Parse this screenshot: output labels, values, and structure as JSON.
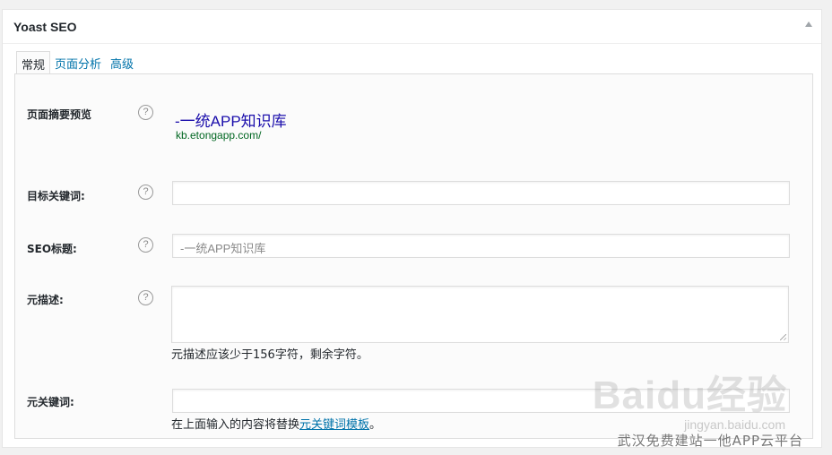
{
  "metabox": {
    "title": "Yoast SEO"
  },
  "tabs": [
    {
      "label": "常规"
    },
    {
      "label": "页面分析"
    },
    {
      "label": "高级"
    }
  ],
  "snippet": {
    "label": "页面摘要预览",
    "title": "-一统APP知识库",
    "url": "kb.etongapp.com/"
  },
  "focus_keyword": {
    "label": "目标关键词:",
    "value": ""
  },
  "seo_title": {
    "label": "SEO标题:",
    "placeholder": "-一统APP知识库"
  },
  "meta_desc": {
    "label": "元描述:",
    "hint": "元描述应该少于156字符，剩余字符。"
  },
  "meta_keywords": {
    "label": "元关键词:",
    "hint_prefix": "在上面输入的内容将替换",
    "hint_link": "元关键词模板",
    "hint_suffix": "。"
  },
  "help_glyph": "?",
  "watermark": {
    "logo_text": "Baidu经验",
    "sub": "jingyan.baidu.com",
    "caption": "武汉免费建站一他APP云平台"
  },
  "colors": {
    "link": "#0073aa",
    "snippet_title": "#1a0dab",
    "snippet_url": "#006621"
  }
}
